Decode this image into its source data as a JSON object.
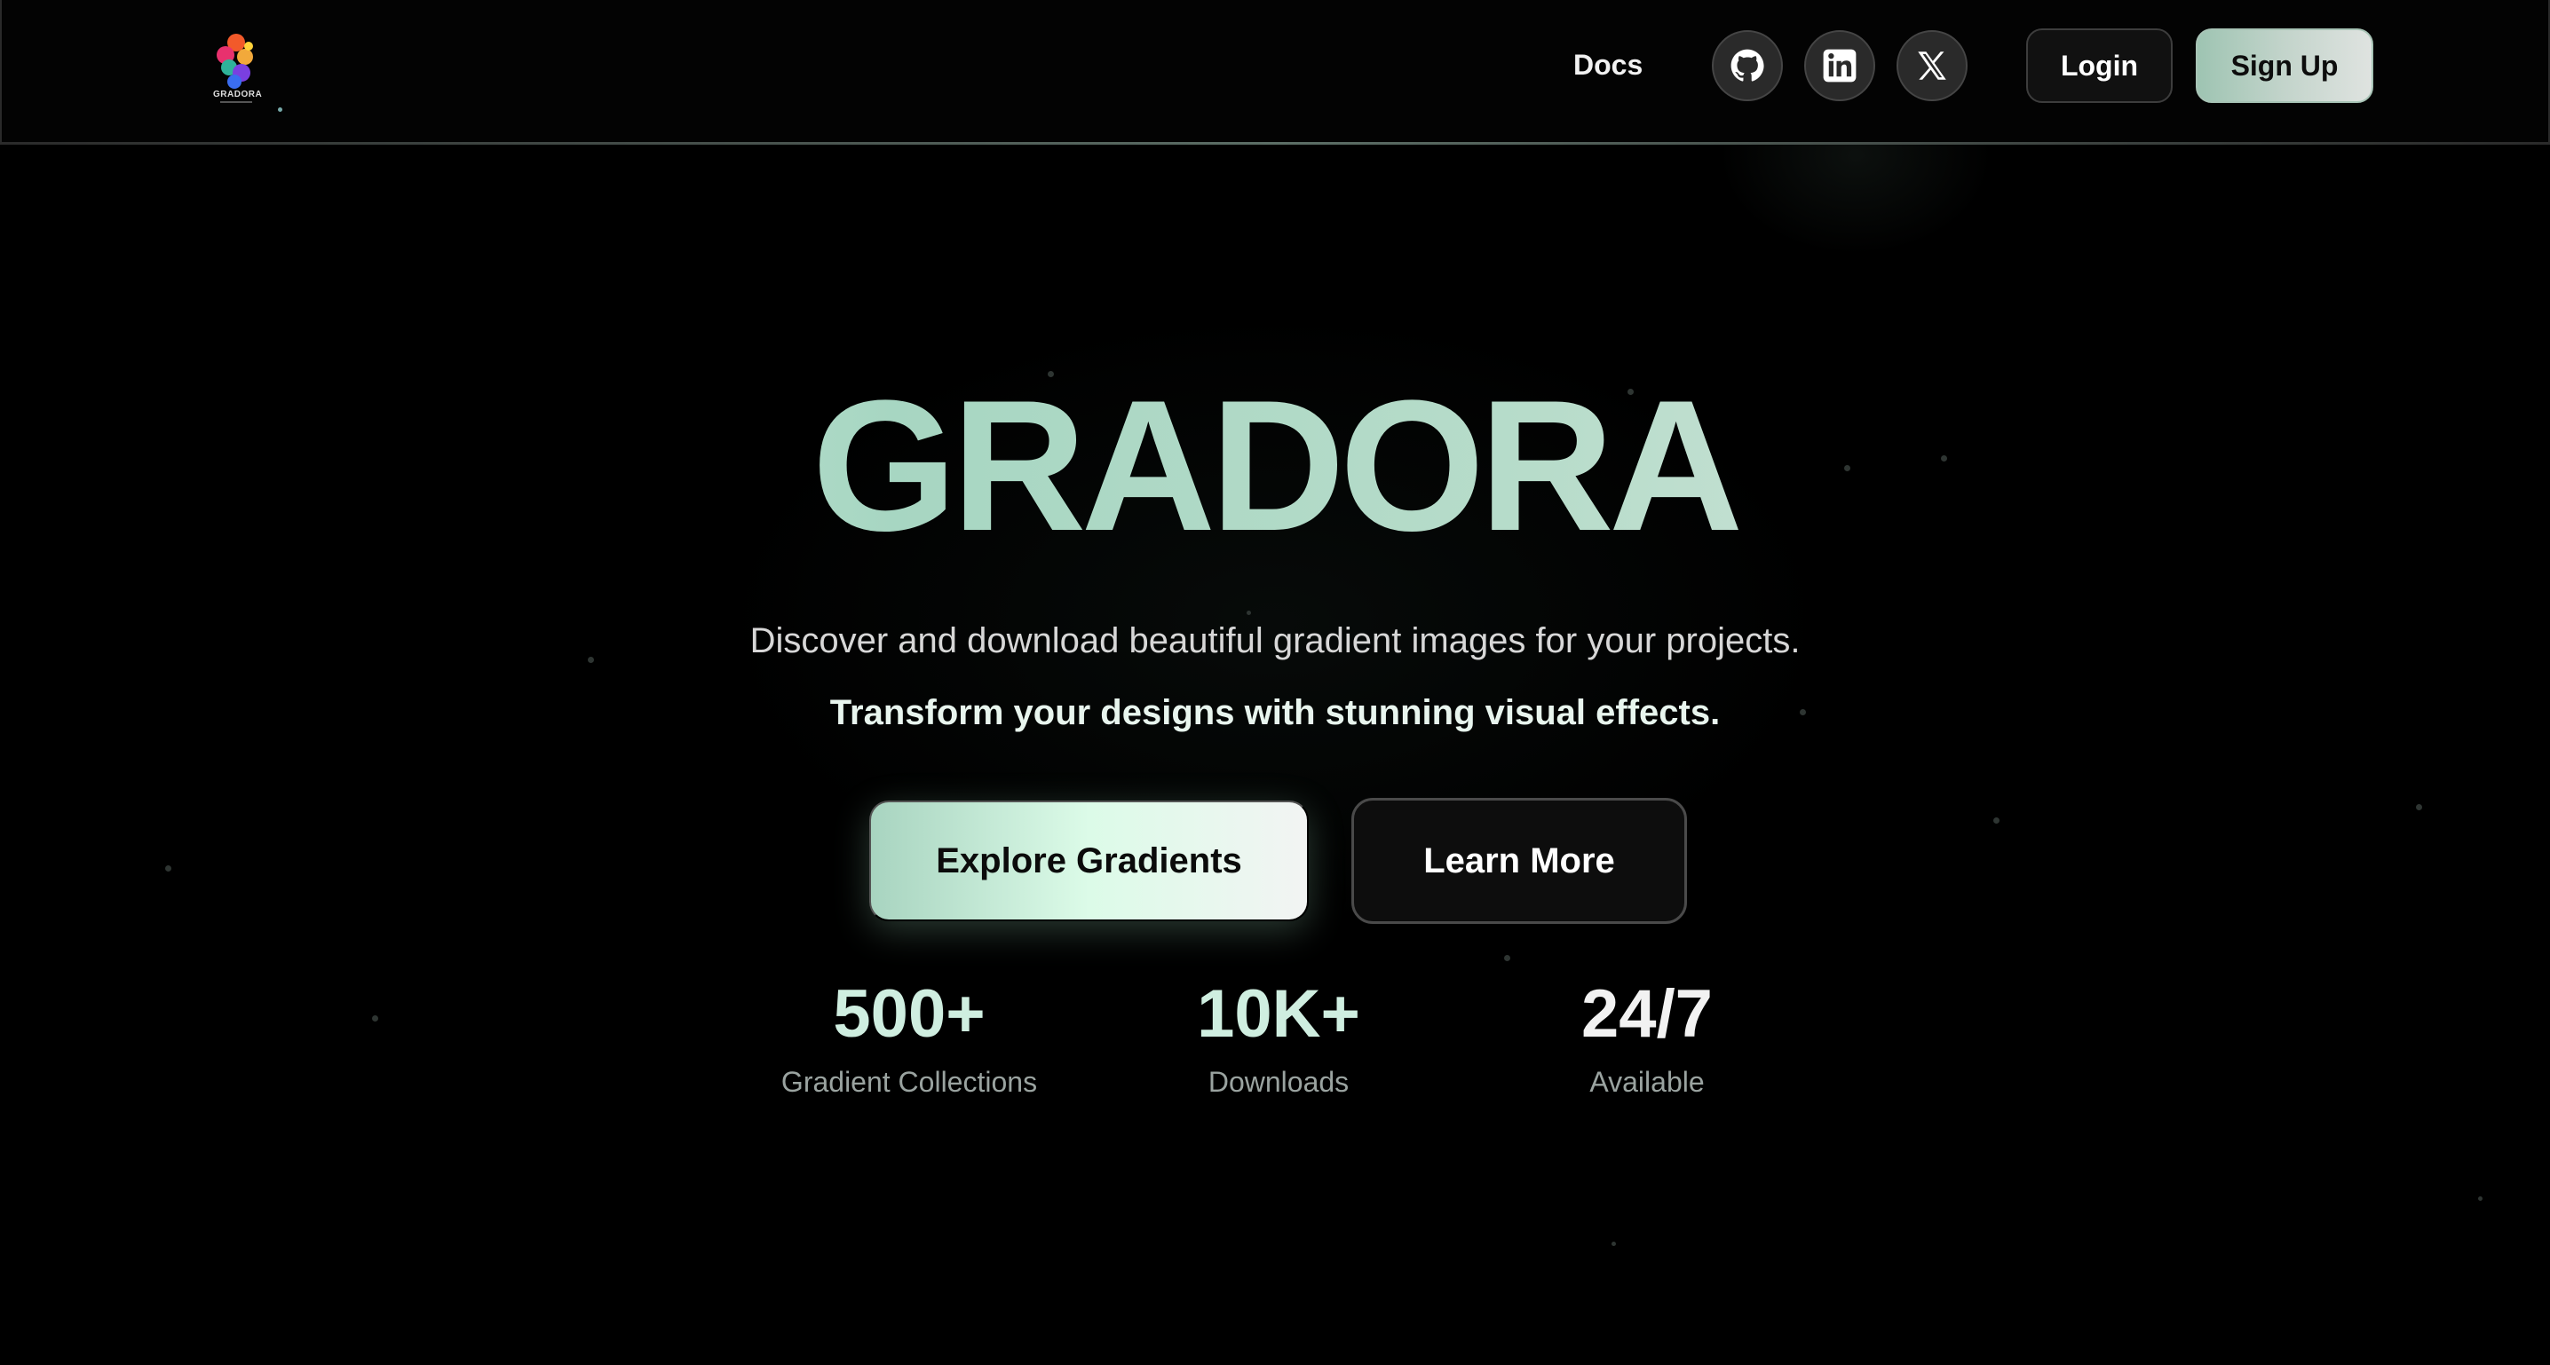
{
  "brand": {
    "name": "GRADORA",
    "logo_text": "GRADORA"
  },
  "nav": {
    "docs_label": "Docs",
    "social": [
      {
        "icon": "github-icon"
      },
      {
        "icon": "linkedin-icon"
      },
      {
        "icon": "x-icon"
      }
    ],
    "login_label": "Login",
    "signup_label": "Sign Up"
  },
  "hero": {
    "title": "GRADORA",
    "subtitle": "Discover and download beautiful gradient images for your projects.",
    "tagline": "Transform your designs with stunning visual effects.",
    "primary_cta": "Explore Gradients",
    "secondary_cta": "Learn More"
  },
  "stats": [
    {
      "value": "500+",
      "label": "Gradient Collections"
    },
    {
      "value": "10K+",
      "label": "Downloads"
    },
    {
      "value": "24/7",
      "label": "Available"
    }
  ],
  "colors": {
    "background": "#000000",
    "accent_mint": "#a7d6c2",
    "accent_light": "#dcfbe8",
    "stat_value_1": "#cfeee0",
    "stat_value_2": "#cfeee0",
    "stat_value_3": "#f2f2f2"
  }
}
